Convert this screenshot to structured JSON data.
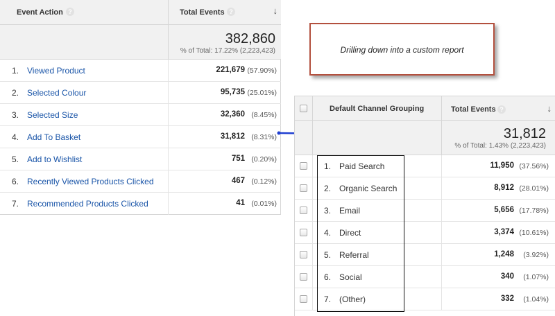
{
  "left_table": {
    "header": {
      "dimension": "Event Action",
      "metric": "Total Events",
      "sort_icon": "sort-descending-arrow"
    },
    "total": {
      "value": "382,860",
      "pct_of_total": "% of Total: 17.22% (2,223,423)"
    },
    "rows": [
      {
        "index": "1.",
        "label": "Viewed Product",
        "value": "221,679",
        "pct": "(57.90%)"
      },
      {
        "index": "2.",
        "label": "Selected Colour",
        "value": "95,735",
        "pct": "(25.01%)"
      },
      {
        "index": "3.",
        "label": "Selected Size",
        "value": "32,360",
        "pct": "(8.45%)"
      },
      {
        "index": "4.",
        "label": "Add To Basket",
        "value": "31,812",
        "pct": "(8.31%)"
      },
      {
        "index": "5.",
        "label": "Add to Wishlist",
        "value": "751",
        "pct": "(0.20%)"
      },
      {
        "index": "6.",
        "label": "Recently Viewed Products Clicked",
        "value": "467",
        "pct": "(0.12%)"
      },
      {
        "index": "7.",
        "label": "Recommended Products Clicked",
        "value": "41",
        "pct": "(0.01%)"
      }
    ]
  },
  "callout": {
    "text": "Drilling down into a custom report",
    "border_color": "#b3503e"
  },
  "arrow": {
    "color": "#1f3fd1"
  },
  "right_table": {
    "header": {
      "dimension": "Default Channel Grouping",
      "metric": "Total Events",
      "sort_icon": "sort-descending-arrow"
    },
    "total": {
      "value": "31,812",
      "pct_of_total": "% of Total: 1.43% (2,223,423)"
    },
    "rows": [
      {
        "index": "1.",
        "label": "Paid Search",
        "value": "11,950",
        "pct": "(37.56%)"
      },
      {
        "index": "2.",
        "label": "Organic Search",
        "value": "8,912",
        "pct": "(28.01%)"
      },
      {
        "index": "3.",
        "label": "Email",
        "value": "5,656",
        "pct": "(17.78%)"
      },
      {
        "index": "4.",
        "label": "Direct",
        "value": "3,374",
        "pct": "(10.61%)"
      },
      {
        "index": "5.",
        "label": "Referral",
        "value": "1,248",
        "pct": "(3.92%)"
      },
      {
        "index": "6.",
        "label": "Social",
        "value": "340",
        "pct": "(1.07%)"
      },
      {
        "index": "7.",
        "label": "(Other)",
        "value": "332",
        "pct": "(1.04%)"
      }
    ]
  },
  "colors": {
    "link": "#1a55a8",
    "header_bg": "#f1f1f1",
    "border": "#d6d6d6"
  }
}
